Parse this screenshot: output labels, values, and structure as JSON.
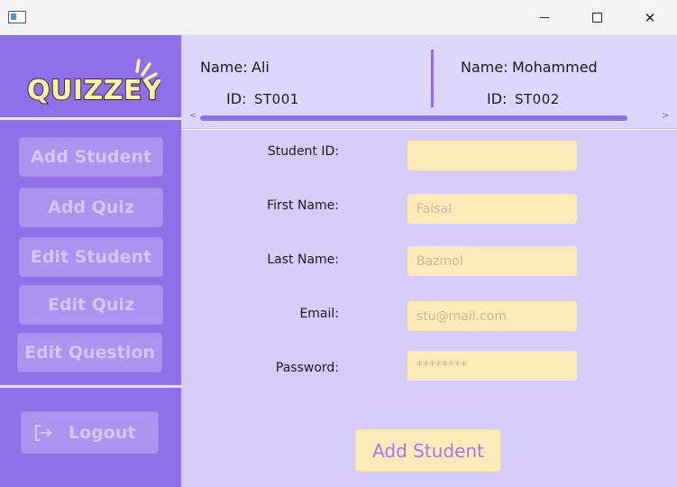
{
  "window": {
    "minimize_icon": "minimize-icon",
    "maximize_icon": "maximize-icon",
    "close_icon": "close-icon",
    "close_glyph": "✕"
  },
  "sidebar": {
    "logo_text": "QUIZZEY",
    "buttons": [
      "Add Student",
      "Add Quiz",
      "Edit Student",
      "Edit Quiz",
      "Edit Question"
    ],
    "logout_label": "Logout",
    "logout_icon": "logout-icon"
  },
  "header": {
    "members": [
      {
        "name_label": "Name:",
        "name": "Ali",
        "id_label": "ID:",
        "id": "ST001"
      },
      {
        "name_label": "Name:",
        "name": "Mohammed",
        "id_label": "ID:",
        "id": "ST002"
      }
    ],
    "scroll_left": "<",
    "scroll_right": ">"
  },
  "form": {
    "fields": [
      {
        "label": "Student ID:",
        "value": "",
        "placeholder": ""
      },
      {
        "label": "First Name:",
        "value": "",
        "placeholder": "Faisal"
      },
      {
        "label": "Last Name:",
        "value": "",
        "placeholder": "Bazmol"
      },
      {
        "label": "Email:",
        "value": "",
        "placeholder": "stu@mail.com"
      },
      {
        "label": "Password:",
        "value": "",
        "placeholder": "********"
      }
    ],
    "submit_label": "Add Student"
  },
  "colors": {
    "sidebar_bg": "#9070e8",
    "header_bg": "#dcd6fd",
    "main_bg": "#d6ccfa",
    "input_bg": "#fdeab8",
    "accent": "#8d6fe6",
    "logo_fill": "#fcefb0"
  }
}
